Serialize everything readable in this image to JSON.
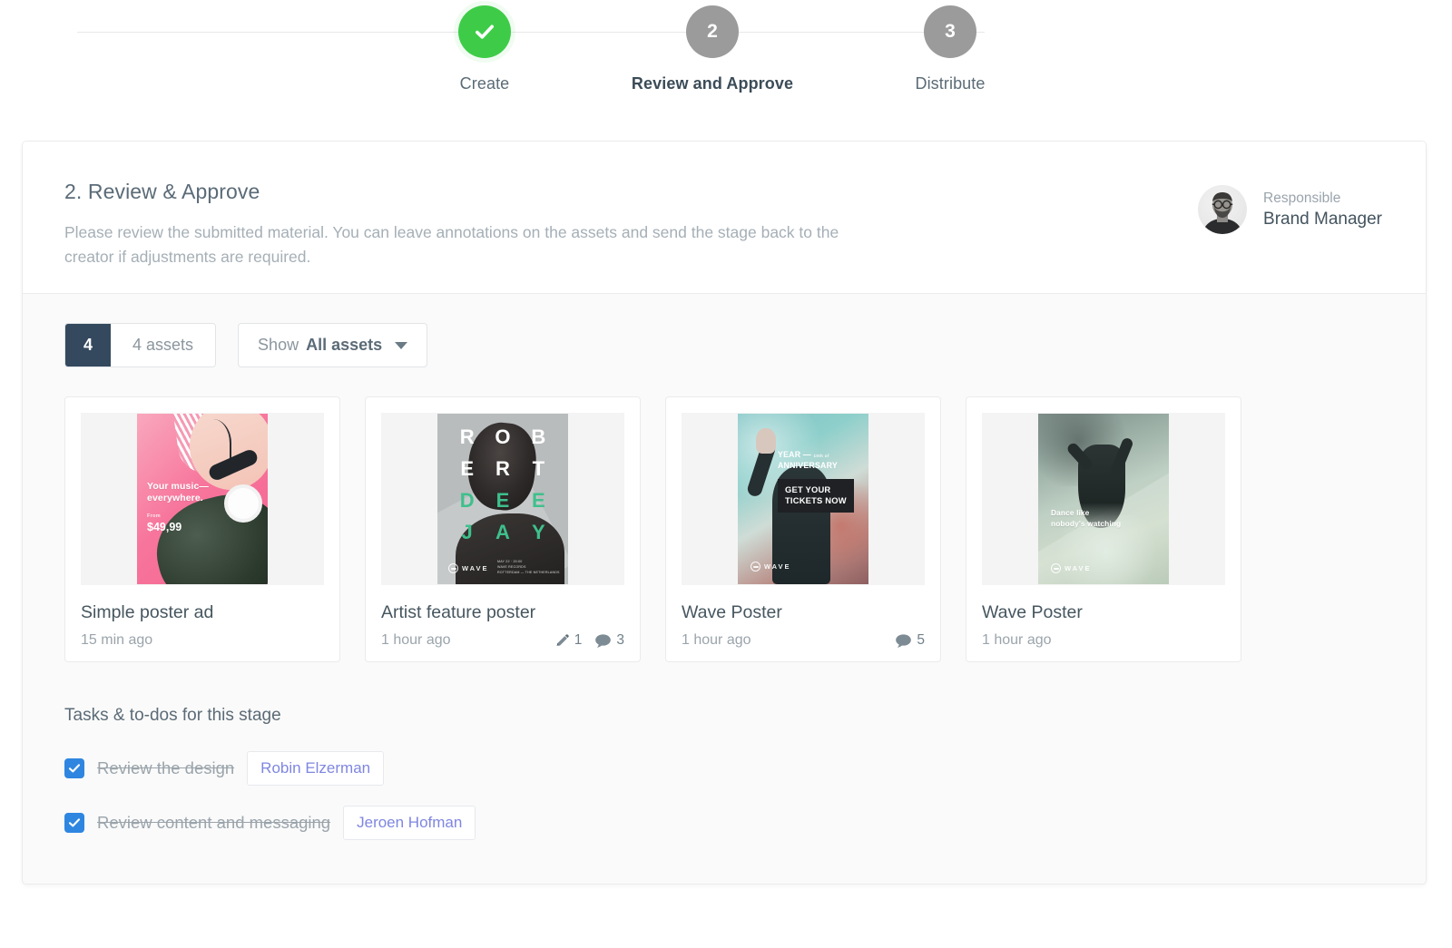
{
  "stepper": {
    "steps": [
      {
        "label": "Create",
        "marker": "check",
        "state": "done"
      },
      {
        "label": "Review and Approve",
        "marker": "2",
        "state": "current"
      },
      {
        "label": "Distribute",
        "marker": "3",
        "state": "upcoming"
      }
    ],
    "colors": {
      "done": "#3ECC48",
      "pending": "#9b9b9b",
      "line": "#e8e8ea"
    }
  },
  "header": {
    "title": "2. Review & Approve",
    "description": "Please review the submitted material. You can leave annotations on the assets and send the stage back to the creator if adjustments are required.",
    "responsible_label": "Responsible",
    "responsible_name": "Brand Manager"
  },
  "filters": {
    "count": "4",
    "count_label": "4 assets",
    "show_prefix": "Show",
    "show_value": "All assets"
  },
  "assets": [
    {
      "name": "Simple poster ad",
      "time": "15 min ago",
      "poster": {
        "headline": "Your music—\never",
        "headline_line1": "Your music—",
        "headline_line2": "everywhere.",
        "from_label": "From",
        "price": "$49,99"
      },
      "stats": []
    },
    {
      "name": "Artist feature poster",
      "time": "1 hour ago",
      "poster": {
        "letters": [
          "R",
          "O",
          "B",
          "E",
          "R",
          "T",
          "D",
          "E",
          "E",
          "J",
          "A",
          "Y"
        ],
        "brand": "WAVE",
        "meta_line1": "MAY 22 · 20:00",
        "meta_line2": "WAVE RECORDS",
        "meta_line3": "ROTTERDAM — THE NETHERLANDS"
      },
      "stats": [
        {
          "icon": "pencil-icon",
          "value": "1"
        },
        {
          "icon": "comment-icon",
          "value": "3"
        }
      ]
    },
    {
      "name": "Wave Poster",
      "time": "1 hour ago",
      "poster": {
        "headline_small": "10th of",
        "headline_line1": "YEAR —",
        "headline_line2": "ANNIVERSARY",
        "cta_line1": "GET YOUR",
        "cta_line2": "TICKETS NOW",
        "brand": "WAVE"
      },
      "stats": [
        {
          "icon": "comment-icon",
          "value": "5"
        }
      ]
    },
    {
      "name": "Wave Poster",
      "time": "1 hour ago",
      "poster": {
        "headline_line1": "Dance like",
        "headline_line2": "nobody's watching",
        "brand": "WAVE"
      },
      "stats": []
    }
  ],
  "tasks": {
    "title": "Tasks & to-dos for this stage",
    "items": [
      {
        "label": "Review the design",
        "assignee": "Robin Elzerman",
        "checked": true
      },
      {
        "label": "Review content and messaging",
        "assignee": "Jeroen Hofman",
        "checked": true
      }
    ]
  },
  "colors": {
    "accent_badge": "#34495e",
    "checkbox_blue": "#2f86e0",
    "assignee_text": "#7f86e0",
    "poster2_green": "#3ec08c",
    "body_bg": "#fafafa"
  }
}
